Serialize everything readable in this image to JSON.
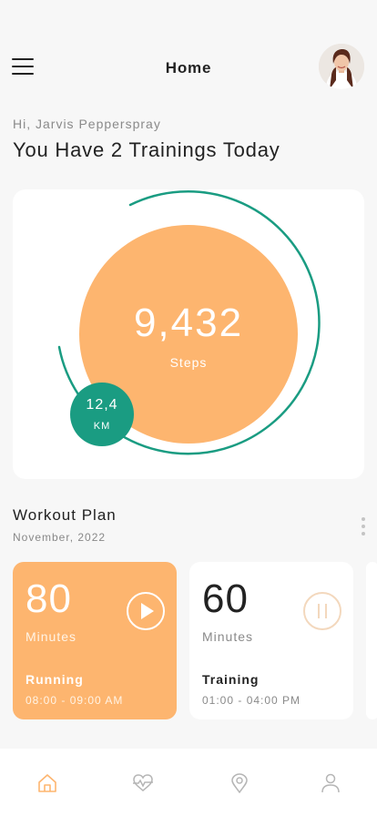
{
  "header": {
    "title": "Home",
    "menu_icon": "hamburger-menu-icon",
    "avatar": "user-avatar"
  },
  "greeting": {
    "hello": "Hi, Jarvis Pepperspray",
    "headline": "You Have 2 Trainings Today"
  },
  "steps": {
    "value": "9,432",
    "label": "Steps",
    "distance_value": "12,4",
    "distance_unit": "KM",
    "colors": {
      "circle": "#fdb56f",
      "ring": "#1a9c82",
      "badge": "#1a9c82"
    }
  },
  "workout_plan": {
    "title": "Workout Plan",
    "date": "November, 2022",
    "cards": [
      {
        "minutes": "80",
        "unit": "Minutes",
        "name": "Running",
        "time": "08:00 - 09:00 AM",
        "action_icon": "play-icon",
        "color": "#fdb56f"
      },
      {
        "minutes": "60",
        "unit": "Minutes",
        "name": "Training",
        "time": "01:00 - 04:00 PM",
        "action_icon": "pause-icon",
        "color": "#ffffff"
      }
    ]
  },
  "bottom_nav": {
    "items": [
      {
        "icon": "home-icon",
        "active": true
      },
      {
        "icon": "heartbeat-icon",
        "active": false
      },
      {
        "icon": "location-pin-icon",
        "active": false
      },
      {
        "icon": "profile-icon",
        "active": false
      }
    ],
    "active_color": "#fdb56f",
    "inactive_color": "#b5b5b5"
  }
}
